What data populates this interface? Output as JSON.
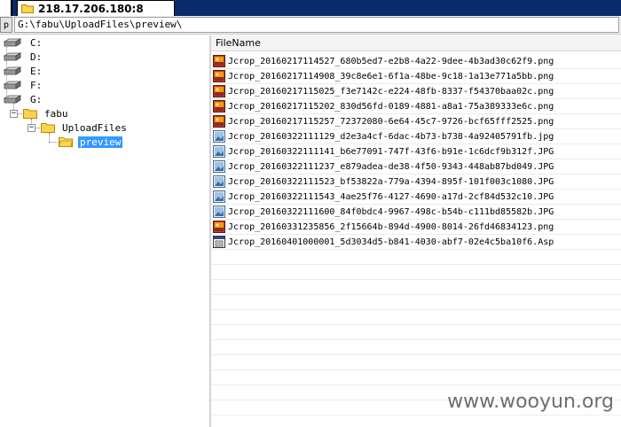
{
  "tab": {
    "title": "218.17.206.180:8",
    "icon": "folder-icon"
  },
  "address": {
    "button_label": "p",
    "path": "G:\\fabu\\UploadFiles\\preview\\"
  },
  "tree": {
    "drives": [
      {
        "label": "C:",
        "icon": "drive-icon"
      },
      {
        "label": "D:",
        "icon": "drive-icon"
      },
      {
        "label": "E:",
        "icon": "drive-icon"
      },
      {
        "label": "F:",
        "icon": "drive-icon"
      },
      {
        "label": "G:",
        "icon": "drive-icon"
      }
    ],
    "folders": [
      {
        "label": "fabu",
        "icon": "folder-icon"
      },
      {
        "label": "UploadFiles",
        "icon": "folder-icon"
      },
      {
        "label": "preview",
        "icon": "folder-open-icon",
        "selected": true
      }
    ]
  },
  "filelist": {
    "column_header": "FileName",
    "files": [
      {
        "name": "Jcrop_20160217114527_680b5ed7-e2b8-4a22-9dee-4b3ad30c62f9.png",
        "type": "png"
      },
      {
        "name": "Jcrop_20160217114908_39c8e6e1-6f1a-48be-9c18-1a13e771a5bb.png",
        "type": "png"
      },
      {
        "name": "Jcrop_20160217115025_f3e7142c-e224-48fb-8337-f54370baa02c.png",
        "type": "png"
      },
      {
        "name": "Jcrop_20160217115202_830d56fd-0189-4881-a8a1-75a389333e6c.png",
        "type": "png"
      },
      {
        "name": "Jcrop_20160217115257_72372080-6e64-45c7-9726-bcf65fff2525.png",
        "type": "png"
      },
      {
        "name": "Jcrop_20160322111129_d2e3a4cf-6dac-4b73-b738-4a92405791fb.jpg",
        "type": "jpg"
      },
      {
        "name": "Jcrop_20160322111141_b6e77091-747f-43f6-b91e-1c6dcf9b312f.JPG",
        "type": "jpg"
      },
      {
        "name": "Jcrop_20160322111237_e879adea-de38-4f50-9343-448ab87bd049.JPG",
        "type": "jpg"
      },
      {
        "name": "Jcrop_20160322111523_bf53822a-779a-4394-895f-101f003c1080.JPG",
        "type": "jpg"
      },
      {
        "name": "Jcrop_20160322111543_4ae25f76-4127-4690-a17d-2cf84d532c10.JPG",
        "type": "jpg"
      },
      {
        "name": "Jcrop_20160322111600_84f0bdc4-9967-498c-b54b-c111bd85582b.JPG",
        "type": "jpg"
      },
      {
        "name": "Jcrop_20160331235856_2f15664b-894d-4900-8014-26fd46834123.png",
        "type": "png"
      },
      {
        "name": "Jcrop_20160401000001_5d3034d5-b841-4030-abf7-02e4c5ba10f6.Asp",
        "type": "asp"
      }
    ]
  },
  "watermark": "www.wooyun.org"
}
